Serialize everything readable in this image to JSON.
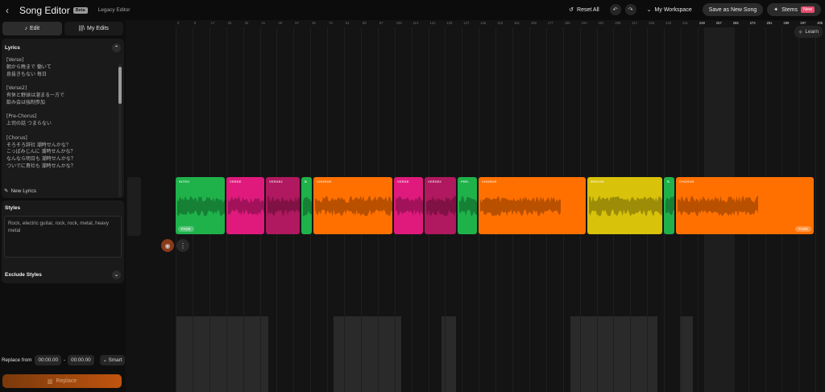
{
  "header": {
    "back_icon": "chevron-left-icon",
    "title": "Song Editor",
    "beta_badge": "Beta",
    "legacy_link": "Legacy Editor",
    "reset_label": "Reset All",
    "workspace_label": "My Workspace",
    "save_label": "Save as New Song",
    "stems_label": "Stems",
    "stems_badge": "New"
  },
  "sidebar": {
    "tabs": [
      {
        "label": "Edit",
        "icon": "music-note-icon",
        "active": true
      },
      {
        "label": "My Edits",
        "icon": "library-icon",
        "active": false
      }
    ],
    "lyrics": {
      "title": "Lyrics",
      "text": "[Verse]\n朝から晩まで 働いて\n息抜きもない 毎日\n\n[Verse2]\n有休と野球は溜まる一方で\n飲み会は強制参加\n\n[Pre-Chorus]\n上司の話 つまらない\n\n[Chorus]\nそろそろ辞社 潮時せんかな？\nこっぱみじんに 潮時せんかな？\nなんなら明日も 潮時せんかな？\nついでに貴社も 潮時せんかな？",
      "new_lyrics_label": "New Lyrics"
    },
    "styles": {
      "title": "Styles",
      "value": "Rock, electric guitar, rock, rock, metal, heavy metal"
    },
    "exclude_styles": {
      "title": "Exclude Styles"
    },
    "replace": {
      "label": "Replace from",
      "start": "00:00.00",
      "separator": "-",
      "end": "00:00.00",
      "smart_label": "Smart",
      "button_label": "Replace"
    }
  },
  "timeline": {
    "learn_label": "Learn",
    "ruler_ticks": [
      "0",
      "9",
      "17",
      "25",
      "33",
      "41",
      "49",
      "57",
      "65",
      "73",
      "81",
      "89",
      "97",
      "105",
      "113",
      "121",
      "129",
      "137",
      "145",
      "153",
      "161",
      "169",
      "177",
      "185",
      "193",
      "201",
      "209",
      "217",
      "225",
      "233",
      "241",
      "249",
      "257",
      "265",
      "273",
      "281",
      "289",
      "297",
      "305"
    ],
    "segments": [
      {
        "label": "INTRO",
        "color": "#1fb24a"
      },
      {
        "label": "VERSE",
        "color": "#e01a7d"
      },
      {
        "label": "VERSE2",
        "color": "#b0185f"
      },
      {
        "label": "B",
        "color": "#1fb24a"
      },
      {
        "label": "CHORUS",
        "color": "#ff7000"
      },
      {
        "label": "VERSE",
        "color": "#e01a7d"
      },
      {
        "label": "VERSE2",
        "color": "#b0185f"
      },
      {
        "label": "PRE-",
        "color": "#1fb24a"
      },
      {
        "label": "CHORUS",
        "color": "#ff7000"
      },
      {
        "label": "BRIDGE",
        "color": "#d8c20a"
      },
      {
        "label": "B",
        "color": "#1fb24a"
      },
      {
        "label": "CHORUS",
        "color": "#ff7000"
      }
    ],
    "fade_in_label": "FADE",
    "fade_out_label": "FADE"
  }
}
